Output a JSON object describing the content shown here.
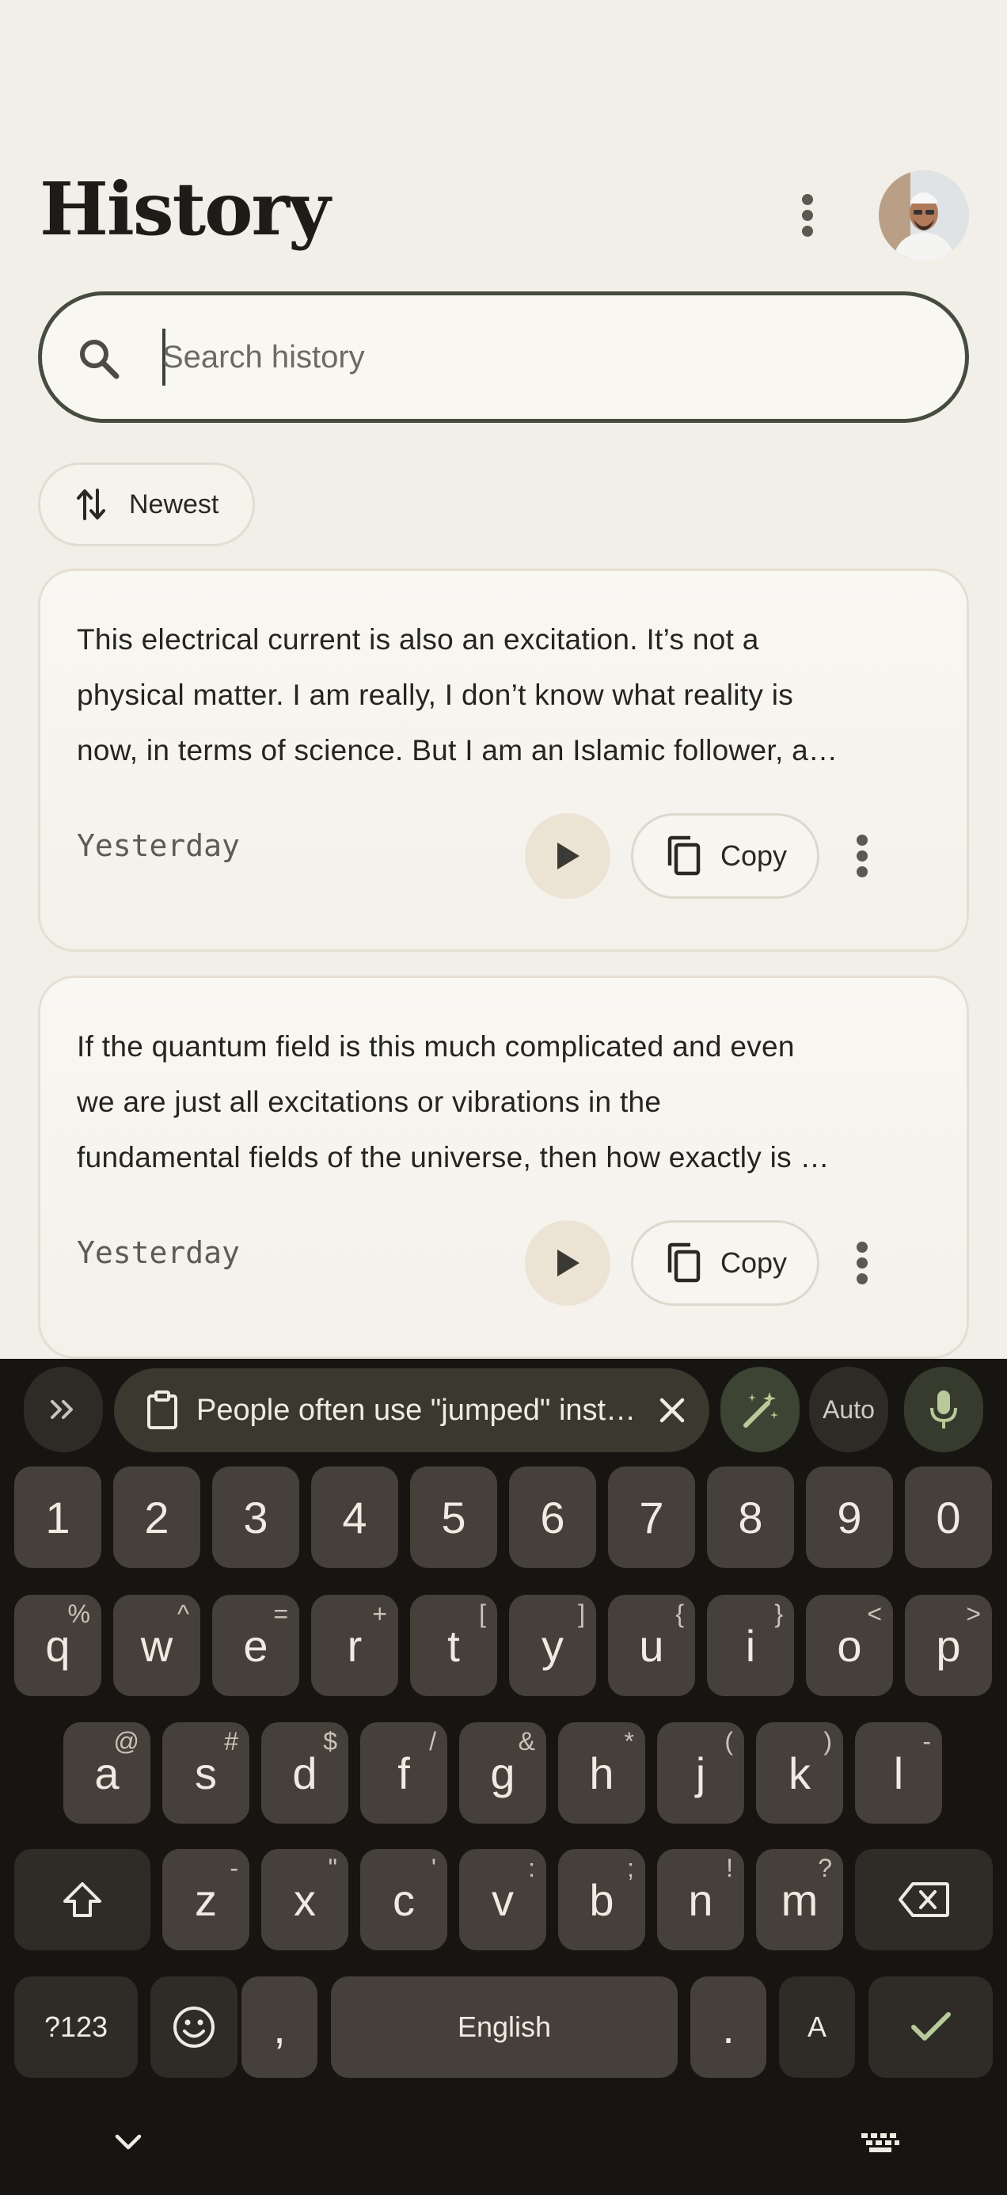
{
  "header": {
    "title": "History"
  },
  "search": {
    "placeholder": "Search history"
  },
  "sort": {
    "label": "Newest"
  },
  "cards": [
    {
      "lines": [
        "This electrical current is also an excitation. It’s not a",
        "physical matter. I am really, I don’t know what reality is",
        "now, in terms of science. But I am an Islamic follower, a…"
      ],
      "date": "Yesterday",
      "copy_label": "Copy"
    },
    {
      "lines": [
        "If the quantum field is this much complicated and even",
        "we are just all excitations or vibrations in the",
        "fundamental fields of the universe, then how exactly is …"
      ],
      "date": "Yesterday",
      "copy_label": "Copy"
    }
  ],
  "keyboard": {
    "suggestion": "People often use \"jumped\" inst…",
    "auto_label": "Auto",
    "number_row": [
      "1",
      "2",
      "3",
      "4",
      "5",
      "6",
      "7",
      "8",
      "9",
      "0"
    ],
    "row1": [
      {
        "k": "q",
        "h": "%"
      },
      {
        "k": "w",
        "h": "^"
      },
      {
        "k": "e",
        "h": "="
      },
      {
        "k": "r",
        "h": "+"
      },
      {
        "k": "t",
        "h": "["
      },
      {
        "k": "y",
        "h": "]"
      },
      {
        "k": "u",
        "h": "{"
      },
      {
        "k": "i",
        "h": "}"
      },
      {
        "k": "o",
        "h": "<"
      },
      {
        "k": "p",
        "h": ">"
      }
    ],
    "row2": [
      {
        "k": "a",
        "h": "@"
      },
      {
        "k": "s",
        "h": "#"
      },
      {
        "k": "d",
        "h": "$"
      },
      {
        "k": "f",
        "h": "/"
      },
      {
        "k": "g",
        "h": "&"
      },
      {
        "k": "h",
        "h": "*"
      },
      {
        "k": "j",
        "h": "("
      },
      {
        "k": "k",
        "h": ")"
      },
      {
        "k": "l",
        "h": "-"
      }
    ],
    "row3": [
      {
        "k": "z",
        "h": "-"
      },
      {
        "k": "x",
        "h": "\""
      },
      {
        "k": "c",
        "h": "'"
      },
      {
        "k": "v",
        "h": ":"
      },
      {
        "k": "b",
        "h": ";"
      },
      {
        "k": "n",
        "h": "!"
      },
      {
        "k": "m",
        "h": "?"
      }
    ],
    "symbols_label": "?123",
    "comma_label": ",",
    "space_label": "English",
    "period_label": ".",
    "lang_label": "A"
  },
  "colors": {
    "background": "#f2efe8",
    "keyboard_bg": "#171512",
    "key": "#45413a",
    "accent": "#464c3e"
  }
}
